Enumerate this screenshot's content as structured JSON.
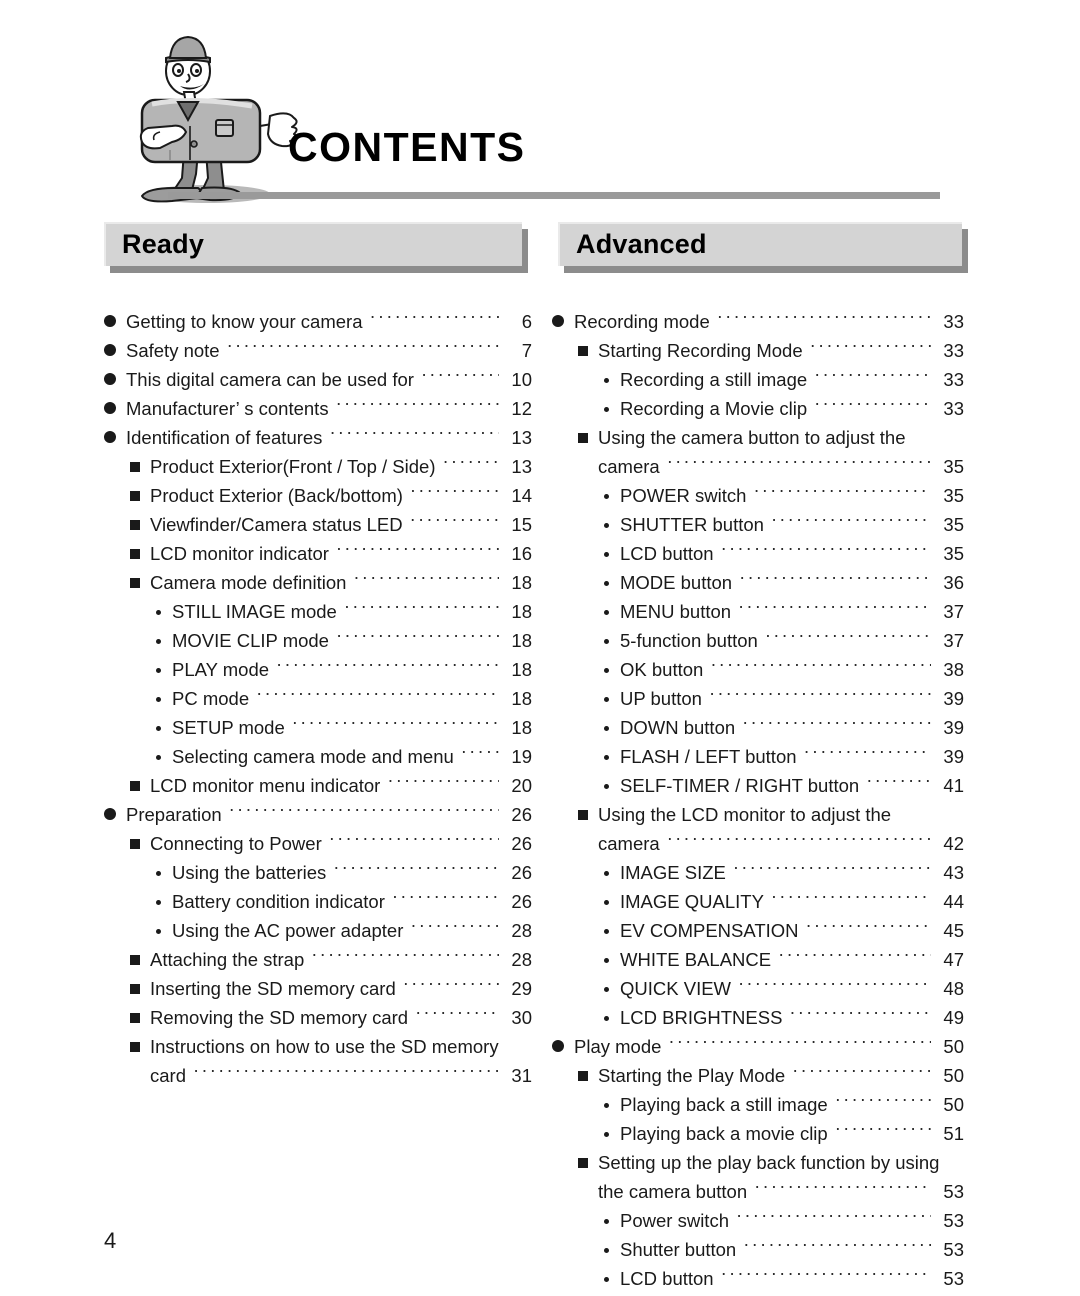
{
  "document": {
    "title": "CONTENTS",
    "page_number": "4",
    "mascot_alt": "camera-mascot-character"
  },
  "sections": [
    {
      "id": "ready",
      "header": "Ready",
      "entries": [
        {
          "level": 1,
          "text": "Getting to know your camera",
          "page": "6"
        },
        {
          "level": 1,
          "text": "Safety note",
          "page": "7"
        },
        {
          "level": 1,
          "text": "This digital camera can be used for",
          "page": "10"
        },
        {
          "level": 1,
          "text": "Manufacturer’ s contents",
          "page": "12"
        },
        {
          "level": 1,
          "text": "Identification of features",
          "page": "13"
        },
        {
          "level": 2,
          "text": "Product Exterior(Front / Top / Side)",
          "page": "13"
        },
        {
          "level": 2,
          "text": "Product Exterior (Back/bottom)",
          "page": "14"
        },
        {
          "level": 2,
          "text": "Viewfinder/Camera status LED",
          "page": "15"
        },
        {
          "level": 2,
          "text": "LCD monitor indicator",
          "page": "16"
        },
        {
          "level": 2,
          "text": "Camera mode definition",
          "page": "18"
        },
        {
          "level": 3,
          "text": "STILL IMAGE mode",
          "page": "18"
        },
        {
          "level": 3,
          "text": "MOVIE CLIP mode",
          "page": "18"
        },
        {
          "level": 3,
          "text": "PLAY mode",
          "page": "18"
        },
        {
          "level": 3,
          "text": "PC mode",
          "page": "18"
        },
        {
          "level": 3,
          "text": "SETUP mode",
          "page": "18"
        },
        {
          "level": 3,
          "text": "Selecting camera mode and menu",
          "page": "19"
        },
        {
          "level": 2,
          "text": "LCD monitor menu indicator",
          "page": "20"
        },
        {
          "level": 1,
          "text": "Preparation",
          "page": "26"
        },
        {
          "level": 2,
          "text": "Connecting to Power",
          "page": "26"
        },
        {
          "level": 3,
          "text": "Using the batteries",
          "page": "26"
        },
        {
          "level": 3,
          "text": "Battery condition indicator",
          "page": "26"
        },
        {
          "level": 3,
          "text": "Using the AC power adapter",
          "page": "28"
        },
        {
          "level": 2,
          "text": "Attaching the strap",
          "page": "28"
        },
        {
          "level": 2,
          "text": "Inserting the SD memory card",
          "page": "29"
        },
        {
          "level": 2,
          "text": "Removing the SD memory card",
          "page": "30"
        },
        {
          "level": 2,
          "text": "Instructions on how to use the SD memory",
          "page": "",
          "dots": false
        },
        {
          "level": "c2",
          "text": "card",
          "page": "31"
        }
      ]
    },
    {
      "id": "advanced",
      "header": "Advanced",
      "entries": [
        {
          "level": 1,
          "text": "Recording mode",
          "page": "33"
        },
        {
          "level": 2,
          "text": "Starting Recording Mode",
          "page": "33"
        },
        {
          "level": 3,
          "text": "Recording a still image",
          "page": "33"
        },
        {
          "level": 3,
          "text": "Recording a Movie clip",
          "page": "33"
        },
        {
          "level": 2,
          "text": "Using the camera button to adjust the",
          "page": "",
          "dots": false
        },
        {
          "level": "c2",
          "text": "camera",
          "page": "35"
        },
        {
          "level": 3,
          "text": "POWER switch",
          "page": "35"
        },
        {
          "level": 3,
          "text": "SHUTTER button",
          "page": "35"
        },
        {
          "level": 3,
          "text": "LCD button",
          "page": "35"
        },
        {
          "level": 3,
          "text": "MODE button",
          "page": "36"
        },
        {
          "level": 3,
          "text": "MENU button",
          "page": "37"
        },
        {
          "level": 3,
          "text": "5-function button",
          "page": "37"
        },
        {
          "level": 3,
          "text": "OK button",
          "page": "38"
        },
        {
          "level": 3,
          "text": "UP button",
          "page": "39"
        },
        {
          "level": 3,
          "text": "DOWN button",
          "page": "39"
        },
        {
          "level": 3,
          "text": "FLASH / LEFT button",
          "page": "39"
        },
        {
          "level": 3,
          "text": "SELF-TIMER / RIGHT button",
          "page": "41"
        },
        {
          "level": 2,
          "text": "Using the LCD monitor to adjust the",
          "page": "",
          "dots": false
        },
        {
          "level": "c2",
          "text": "camera",
          "page": "42"
        },
        {
          "level": 3,
          "text": "IMAGE SIZE",
          "page": "43"
        },
        {
          "level": 3,
          "text": "IMAGE QUALITY",
          "page": "44"
        },
        {
          "level": 3,
          "text": "EV COMPENSATION",
          "page": "45"
        },
        {
          "level": 3,
          "text": "WHITE BALANCE",
          "page": "47"
        },
        {
          "level": 3,
          "text": "QUICK VIEW",
          "page": "48"
        },
        {
          "level": 3,
          "text": "LCD BRIGHTNESS",
          "page": "49"
        },
        {
          "level": 1,
          "text": "Play mode",
          "page": "50"
        },
        {
          "level": 2,
          "text": "Starting the Play Mode",
          "page": "50"
        },
        {
          "level": 3,
          "text": "Playing back a still image",
          "page": "50"
        },
        {
          "level": 3,
          "text": "Playing back a movie clip",
          "page": "51"
        },
        {
          "level": 2,
          "text": "Setting up the play back function by using",
          "page": "",
          "dots": false
        },
        {
          "level": "c2",
          "text": "the camera button",
          "page": "53"
        },
        {
          "level": 3,
          "text": "Power switch",
          "page": "53"
        },
        {
          "level": 3,
          "text": "Shutter button",
          "page": "53"
        },
        {
          "level": 3,
          "text": "LCD button",
          "page": "53"
        }
      ]
    }
  ],
  "colors": {
    "bar_face": "#d4d4d4",
    "bar_shadow": "#8c8c8c",
    "rule": "#9a9a9a",
    "text": "#1a1a1a"
  }
}
